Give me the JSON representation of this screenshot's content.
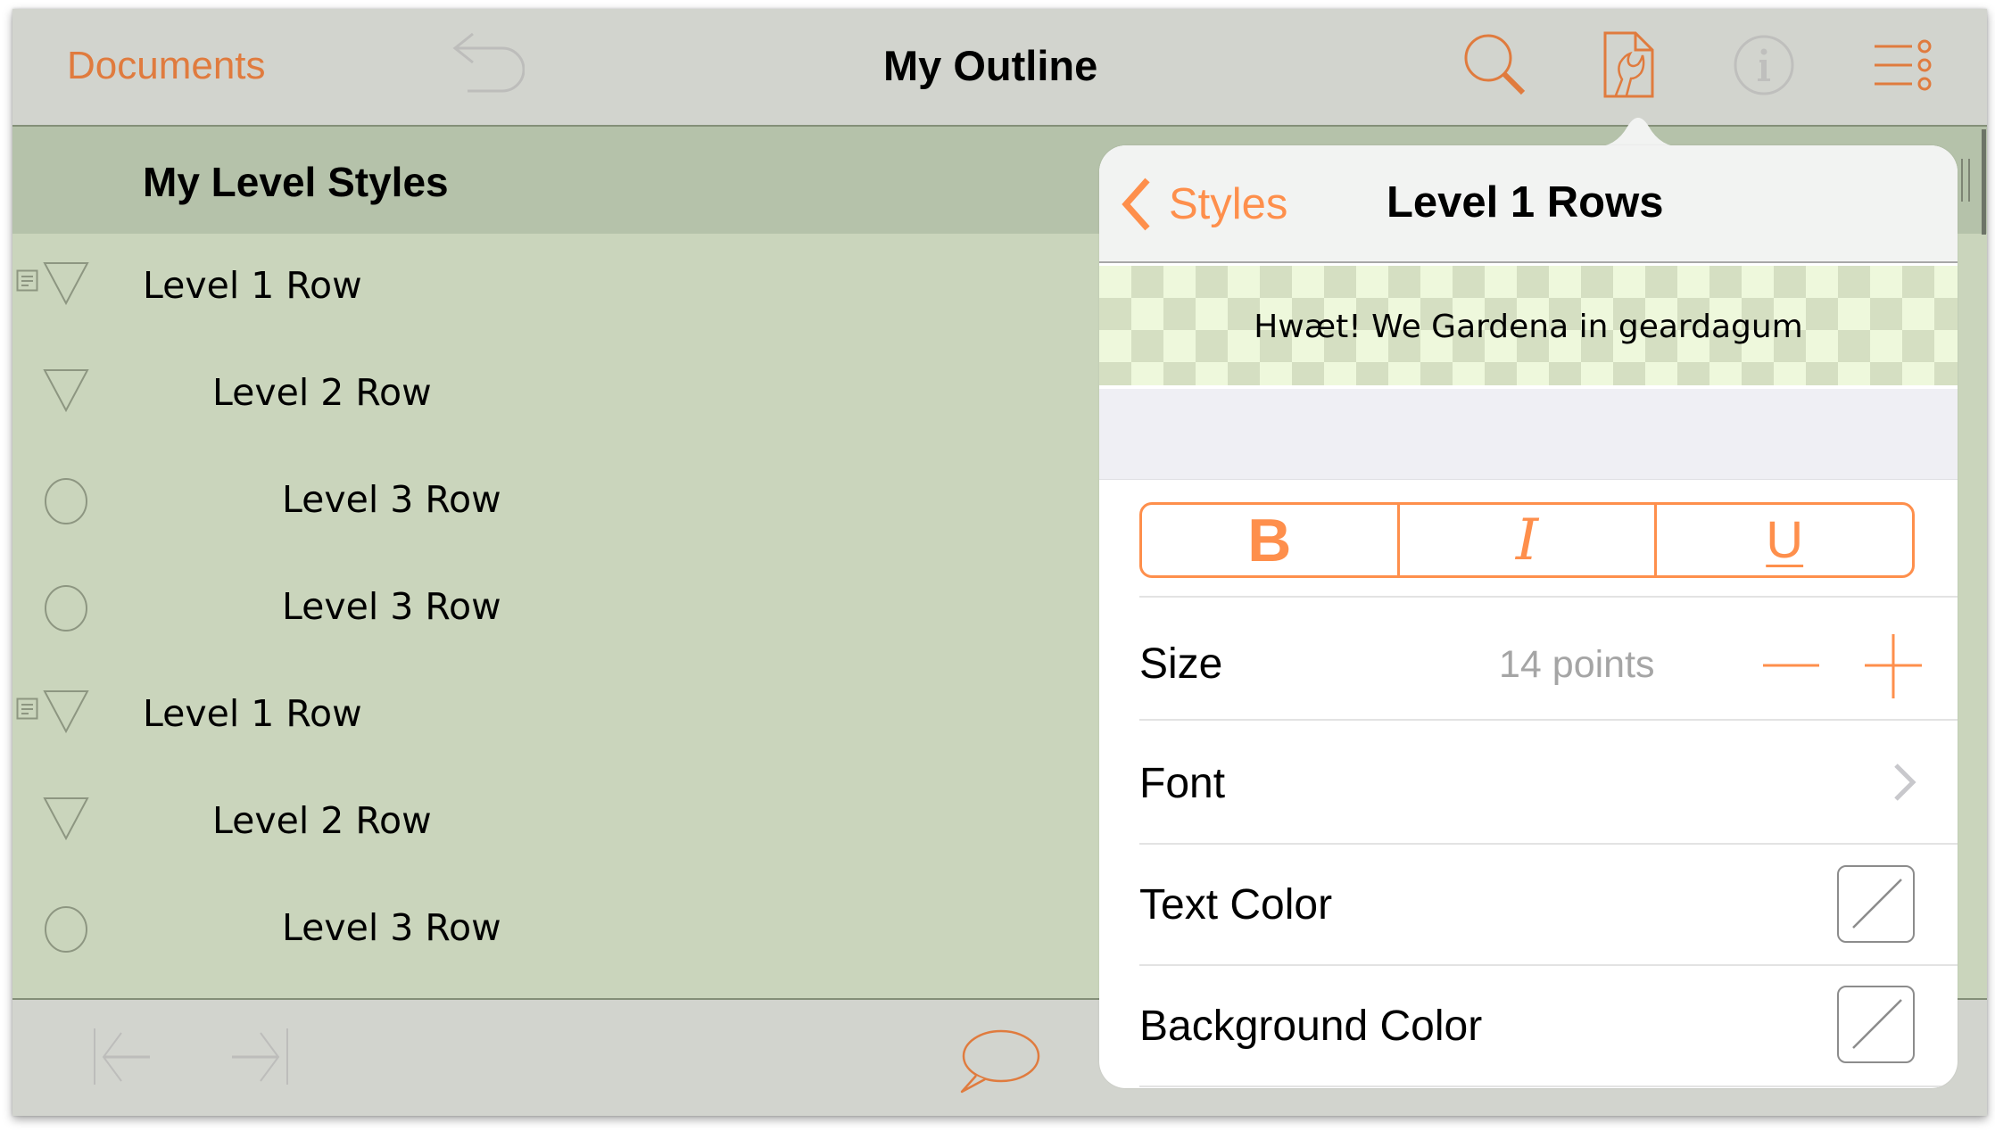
{
  "topbar": {
    "documents_label": "Documents",
    "title": "My Outline",
    "icons": [
      "undo-icon",
      "search-icon",
      "style-icon",
      "info-icon",
      "more-menu-icon"
    ]
  },
  "outline": {
    "section_title": "My Level Styles",
    "rows": [
      {
        "label": "Level 1 Row",
        "level": 1,
        "handle": "disclosure-triangle",
        "has_note": true
      },
      {
        "label": "Level 2 Row",
        "level": 2,
        "handle": "disclosure-triangle",
        "has_note": false
      },
      {
        "label": "Level 3 Row",
        "level": 3,
        "handle": "circle-bullet",
        "has_note": false
      },
      {
        "label": "Level 3 Row",
        "level": 3,
        "handle": "circle-bullet",
        "has_note": false
      },
      {
        "label": "Level 1 Row",
        "level": 1,
        "handle": "disclosure-triangle",
        "has_note": true
      },
      {
        "label": "Level 2 Row",
        "level": 2,
        "handle": "disclosure-triangle",
        "has_note": false
      },
      {
        "label": "Level 3 Row",
        "level": 3,
        "handle": "circle-bullet",
        "has_note": false
      }
    ]
  },
  "bottombar": {
    "icons": [
      "outdent-icon",
      "indent-icon",
      "comment-icon"
    ]
  },
  "popover": {
    "back_label": "Styles",
    "title": "Level 1 Rows",
    "preview_text": "Hwæt! We Gardena in geardagum",
    "format_buttons": {
      "bold": "B",
      "italic": "I",
      "underline": "U"
    },
    "size": {
      "label": "Size",
      "value": "14 points"
    },
    "font": {
      "label": "Font"
    },
    "text_color": {
      "label": "Text Color",
      "value": "none"
    },
    "background_color": {
      "label": "Background Color",
      "value": "none"
    }
  },
  "colors": {
    "accent": "#e07b3e",
    "popover_accent": "#fe8f4c",
    "toolbar_bg": "#d2d4ce",
    "outline_bg": "#cad5bc",
    "section_bg": "#b5c2aa"
  }
}
